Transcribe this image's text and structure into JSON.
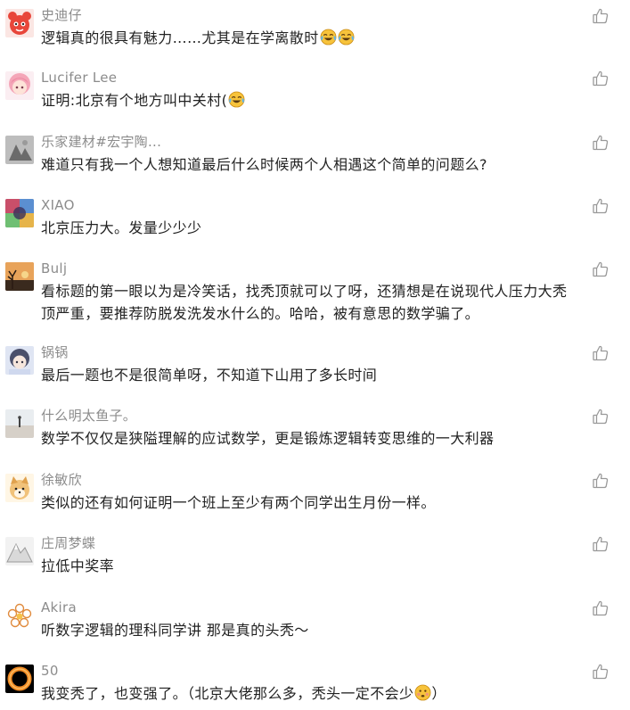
{
  "comments": [
    {
      "name": "史迪仔",
      "text": "逻辑真的很具有魅力……尤其是在学离散时",
      "emoji": [
        "laugh-cry-icon",
        "laugh-cry-icon"
      ],
      "avatar": "red-cartoon-avatar"
    },
    {
      "name": "Lucifer Lee",
      "text": "证明:北京有个地方叫中关村(",
      "emoji": [
        "laugh-cry-icon"
      ],
      "avatar": "pink-hair-anime-avatar"
    },
    {
      "name": "乐家建材#宏宇陶...",
      "text": "难道只有我一个人想知道最后什么时候两个人相遇这个简单的问题么?",
      "emoji": [],
      "avatar": "gray-photo-avatar"
    },
    {
      "name": "XIAO",
      "text": "北京压力大。发量少少少",
      "emoji": [],
      "avatar": "colorful-photo-avatar"
    },
    {
      "name": "Bulj",
      "text": "看标题的第一眼以为是冷笑话，找秃顶就可以了呀，还猜想是在说现代人压力大秃顶严重，要推荐防脱发洗发水什么的。哈哈，被有意思的数学骗了。",
      "emoji": [],
      "avatar": "sunset-tree-avatar"
    },
    {
      "name": "锅锅",
      "text": "最后一题也不是很简单呀，不知道下山用了多长时间",
      "emoji": [],
      "avatar": "anime-girl-avatar"
    },
    {
      "name": "什么明太鱼子。",
      "text": "数学不仅仅是狭隘理解的应试数学，更是锻炼逻辑转变思维的一大利器",
      "emoji": [],
      "avatar": "beach-figure-avatar"
    },
    {
      "name": "徐敏欣",
      "text": "类似的还有如何证明一个班上至少有两个同学出生月份一样。",
      "emoji": [],
      "avatar": "shiba-dog-avatar"
    },
    {
      "name": "庄周梦蝶",
      "text": "拉低中奖率",
      "emoji": [],
      "avatar": "mountain-sketch-avatar"
    },
    {
      "name": "Akira",
      "text": "听数字逻辑的理科同学讲 那是真的头秃～",
      "emoji": [],
      "avatar": "flower-outline-avatar"
    },
    {
      "name": "50",
      "text": "我变秃了，也变强了。（北京大佬那么多，秃头一定不会少",
      "text_after": "）",
      "emoji": [
        "embarrassed-face-icon"
      ],
      "avatar": "black-hole-avatar"
    }
  ],
  "icons": {
    "like": "thumbs-up-icon"
  },
  "colors": {
    "name": "#8c8c8c",
    "text": "#222222",
    "like_icon": "#999999",
    "emoji": "#f7c33b"
  }
}
